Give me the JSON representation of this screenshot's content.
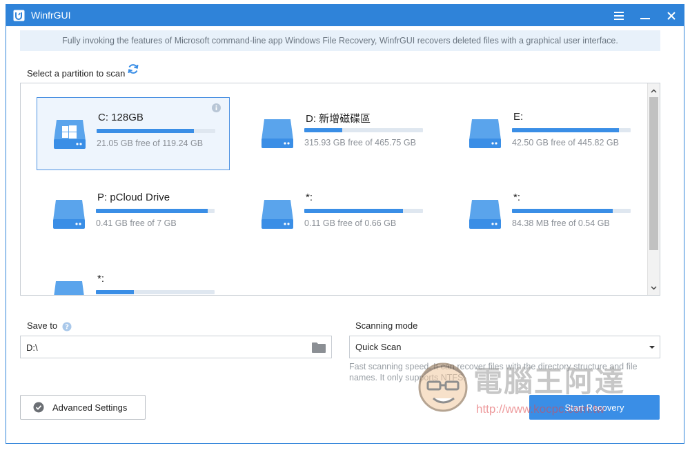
{
  "window": {
    "title": "WinfrGUI"
  },
  "banner": {
    "text": "Fully invoking the features of Microsoft command-line app Windows File Recovery, WinfrGUI recovers deleted files with a graphical user interface."
  },
  "partitions": {
    "label": "Select a partition to scan",
    "items": [
      {
        "name": "C: 128GB",
        "free": "21.05 GB free of 119.24 GB",
        "used_fraction": 0.82,
        "windows_logo": true,
        "selected": true
      },
      {
        "name": "D: 新增磁碟區",
        "free": "315.93 GB free of 465.75 GB",
        "used_fraction": 0.32,
        "windows_logo": false,
        "selected": false
      },
      {
        "name": "E:",
        "free": "42.50 GB free of 445.82 GB",
        "used_fraction": 0.9,
        "windows_logo": false,
        "selected": false
      },
      {
        "name": "P: pCloud Drive",
        "free": "0.41 GB free of 7 GB",
        "used_fraction": 0.94,
        "windows_logo": false,
        "selected": false
      },
      {
        "name": "*:",
        "free": "0.11 GB free of 0.66 GB",
        "used_fraction": 0.83,
        "windows_logo": false,
        "selected": false
      },
      {
        "name": "*:",
        "free": "84.38 MB free of 0.54 GB",
        "used_fraction": 0.85,
        "windows_logo": false,
        "selected": false
      },
      {
        "name": "*:",
        "free": "",
        "used_fraction": 0.32,
        "windows_logo": false,
        "selected": false
      }
    ]
  },
  "save_to": {
    "label": "Save to",
    "value": "D:\\"
  },
  "scanning_mode": {
    "label": "Scanning mode",
    "value": "Quick Scan",
    "description": "Fast scanning speed. It can recover files with the directory structure and file names. It only supports NTFS."
  },
  "buttons": {
    "advanced_settings": "Advanced Settings",
    "start_recovery": "Start Recovery"
  },
  "watermark": {
    "text": "電腦王阿達",
    "url": "http://www.kocpc.com.tw"
  },
  "colors": {
    "accent": "#2f83d9",
    "bar": "#3a8ee6",
    "banner_bg": "#e8f1fa"
  }
}
